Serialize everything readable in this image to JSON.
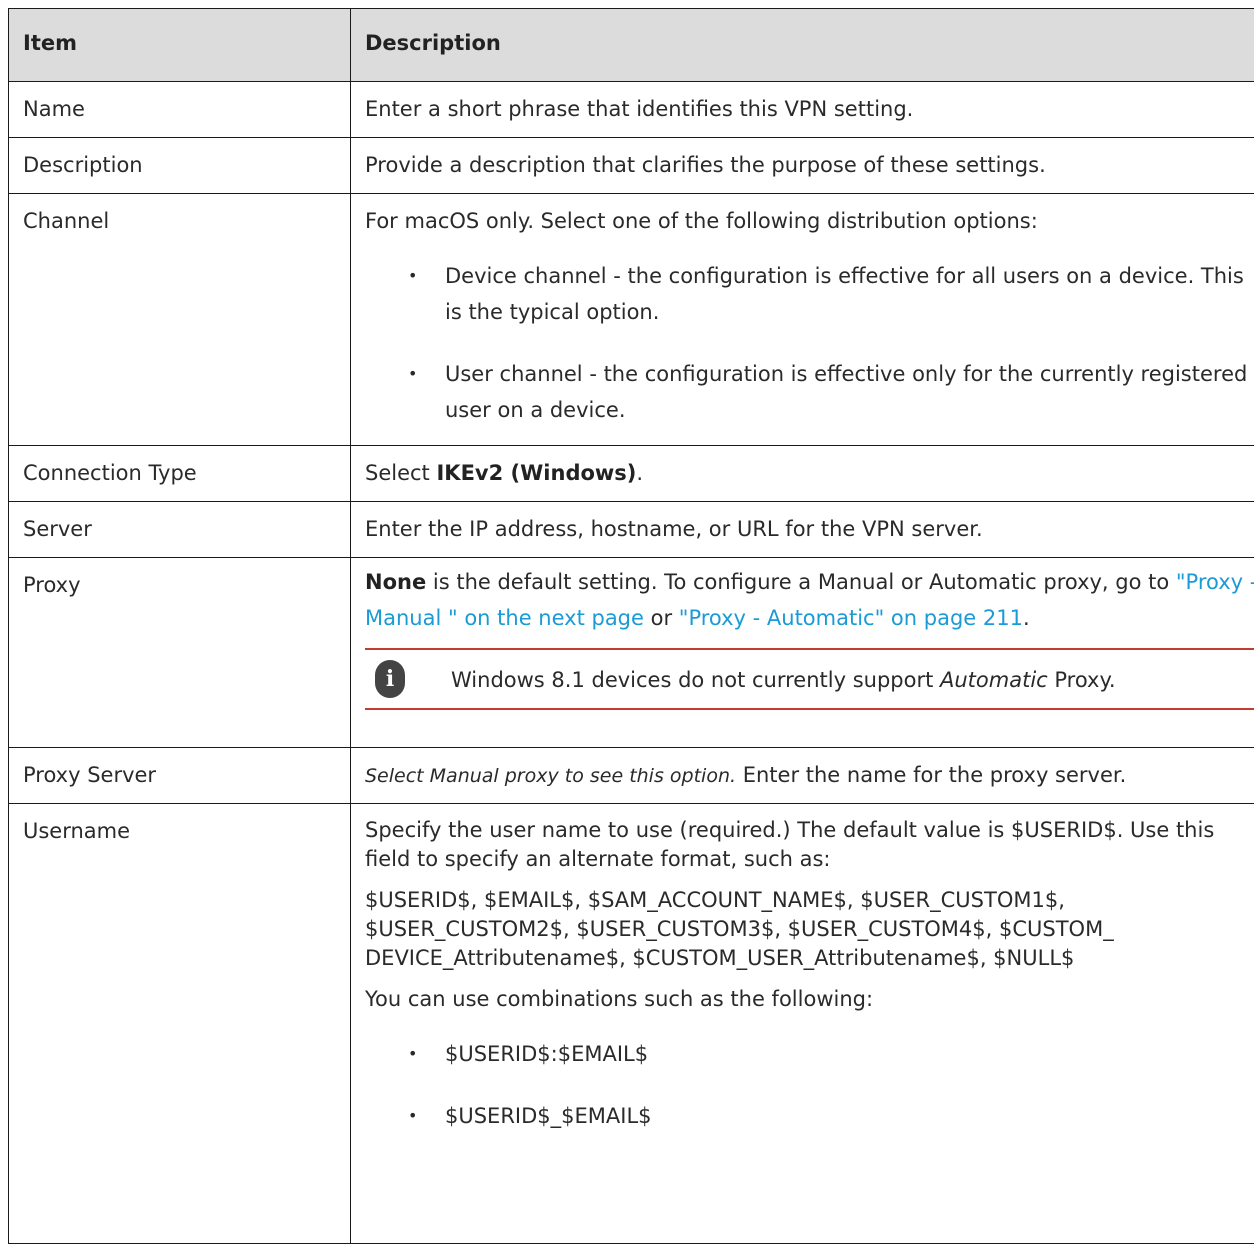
{
  "header": {
    "item": "Item",
    "description": "Description"
  },
  "rows": {
    "name": {
      "item": "Name",
      "desc": "Enter a short phrase that identifies this VPN setting."
    },
    "description": {
      "item": "Description",
      "desc": "Provide a description that clarifies the purpose of these settings."
    },
    "channel": {
      "item": "Channel",
      "intro": "For macOS only. Select one of the following distribution options:",
      "bullets": [
        "Device channel - the configuration is effective for all users on a device. This is the typical option.",
        "User channel - the configuration is effective only for the currently registered user on a device."
      ]
    },
    "connection_type": {
      "item": "Connection Type",
      "prefix": "Select",
      "value": "IKEv2 (Windows)",
      "suffix": "."
    },
    "server": {
      "item": "Server",
      "desc": "Enter the IP address, hostname, or URL for the VPN server."
    },
    "proxy": {
      "item": "Proxy",
      "bold": "None",
      "text1": " is the default setting. To configure a Manual or Automatic proxy, go to ",
      "link1": "\"Proxy - Manual \" on the next page",
      "text2": " or ",
      "link2": "\"Proxy - Automatic\" on page 211",
      "text3": ".",
      "note_before": "Windows 8.1 devices do not currently support ",
      "note_italic": "Automatic",
      "note_after": " Proxy."
    },
    "proxy_server": {
      "item": "Proxy Server",
      "italic": "Select Manual proxy to see this option.",
      "desc": " Enter the name for the proxy server."
    },
    "username": {
      "item": "Username",
      "p1": "Specify the user name to use (required.) The default value is $USERID$. Use this field to specify an alternate format, such as:",
      "p2": "$USERID$, $EMAIL$, $SAM_ACCOUNT_NAME$, $USER_CUSTOM1$, $USER_CUSTOM2$, $USER_CUSTOM3$, $USER_CUSTOM4$, $CUSTOM_ DEVICE_Attributename$, $CUSTOM_USER_Attributename$, $NULL$",
      "p3": "You can use combinations such as the following:",
      "bullets": [
        "$USERID$:$EMAIL$",
        "$USERID$_$EMAIL$"
      ]
    }
  },
  "colors": {
    "link": "#1a9ad6",
    "note_border": "#c43b32",
    "header_bg": "#dcdcdc"
  },
  "icons": {
    "bullet": "•",
    "note": "info-icon"
  }
}
